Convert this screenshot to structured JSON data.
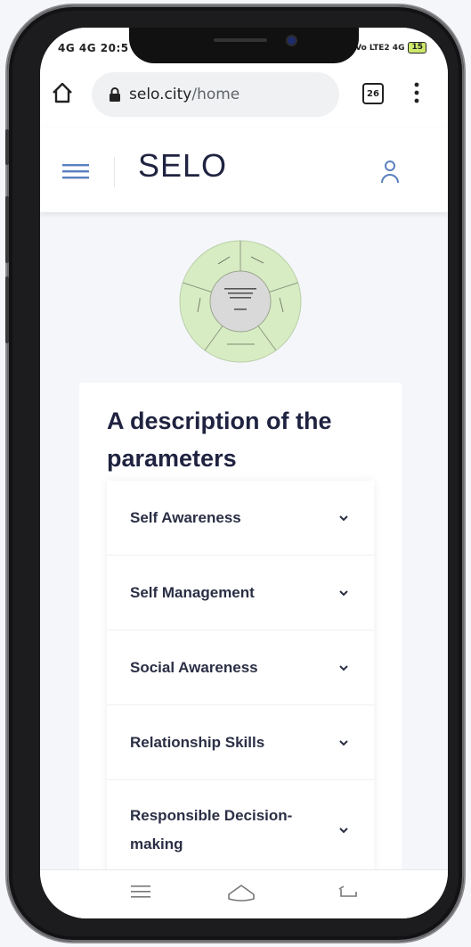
{
  "status_bar": {
    "left_text": "4G 4G 20:5",
    "right_network": "Vo LTE2 4G",
    "battery": "15"
  },
  "browser": {
    "url_domain": "selo.city",
    "url_path": "/home",
    "tab_count": "26"
  },
  "site": {
    "title": "SELO"
  },
  "card": {
    "title": "A description of the parameters"
  },
  "accordion": [
    {
      "label": "Self Awareness"
    },
    {
      "label": "Self Management"
    },
    {
      "label": "Social Awareness"
    },
    {
      "label": "Relationship Skills"
    },
    {
      "label": "Responsible Decision-making"
    }
  ],
  "icons": {
    "home": "home-icon",
    "lock": "lock-icon",
    "tabs": "tabs-icon",
    "menu": "more-vert-icon",
    "hamburger": "hamburger-icon",
    "user": "user-icon",
    "chevron": "chevron-down-icon",
    "nav_menu": "nav-menu-icon",
    "nav_home": "nav-home-icon",
    "nav_back": "nav-back-icon"
  },
  "colors": {
    "title": "#1f2340",
    "wheel_outer": "#d8ecc4",
    "wheel_inner": "#d9d9d9",
    "accent": "#5a7fbf"
  }
}
